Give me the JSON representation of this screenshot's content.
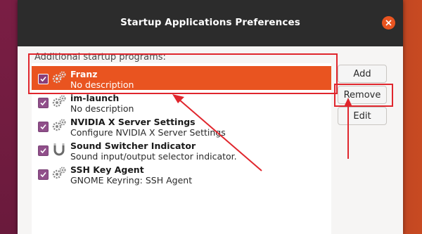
{
  "window": {
    "title": "Startup Applications Preferences"
  },
  "list_header": "Additional startup programs:",
  "programs": [
    {
      "name": "Franz",
      "description": "No description",
      "checked": true,
      "selected": true,
      "icon": "gears-icon"
    },
    {
      "name": "im-launch",
      "description": "No description",
      "checked": true,
      "selected": false,
      "icon": "gears-icon"
    },
    {
      "name": "NVIDIA X Server Settings",
      "description": "Configure NVIDIA X Server Settings",
      "checked": true,
      "selected": false,
      "icon": "gears-icon"
    },
    {
      "name": "Sound Switcher Indicator",
      "description": "Sound input/output selector indicator.",
      "checked": true,
      "selected": false,
      "icon": "horseshoe-magnet-icon"
    },
    {
      "name": "SSH Key Agent",
      "description": "GNOME Keyring: SSH Agent",
      "checked": true,
      "selected": false,
      "icon": "gears-icon"
    }
  ],
  "buttons": {
    "add": "Add",
    "remove": "Remove",
    "edit": "Edit"
  },
  "colors": {
    "selection": "#e95420",
    "titlebar": "#2c2c2c",
    "checkbox": "#904f8a",
    "annotation": "#e0262d"
  }
}
